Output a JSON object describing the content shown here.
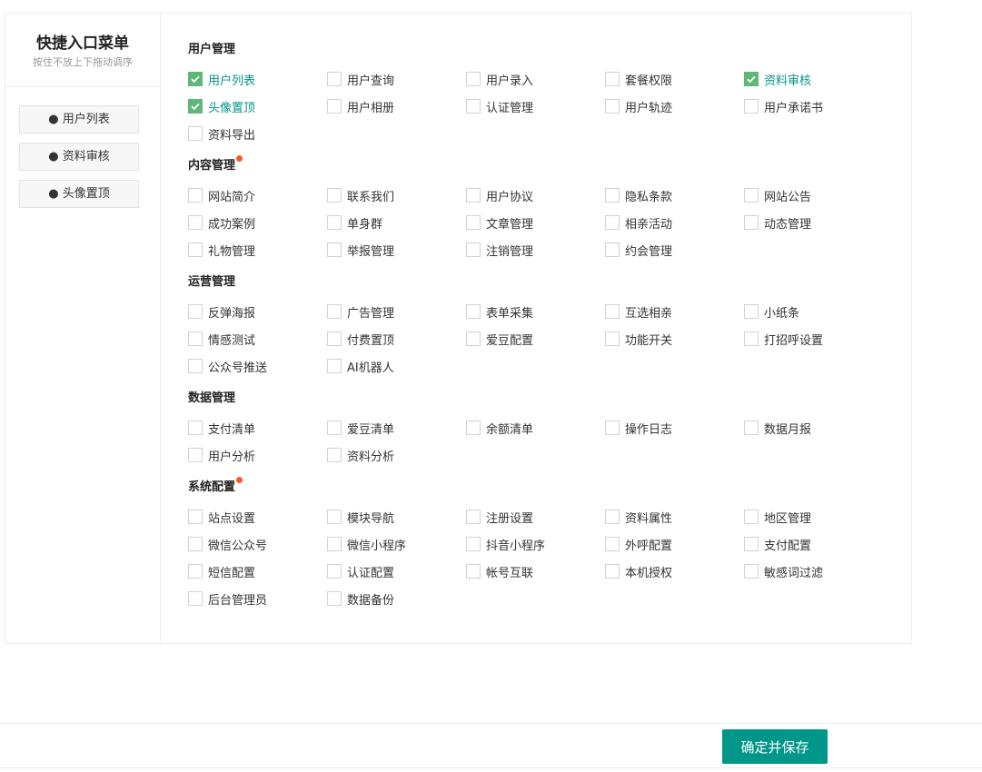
{
  "sidebar": {
    "title": "快捷入口菜单",
    "subtitle": "按住不放上下拖动调序",
    "items": [
      "● 用户列表",
      "● 资料审核",
      "● 头像置顶"
    ]
  },
  "accent": "#009688",
  "check_color": "#5fb878",
  "dot_color": "#ff5722",
  "sections": [
    {
      "title": "用户管理",
      "dot": false,
      "items": [
        {
          "l": "用户列表",
          "c": true
        },
        {
          "l": "用户查询"
        },
        {
          "l": "用户录入"
        },
        {
          "l": "套餐权限"
        },
        {
          "l": "资料审核",
          "c": true
        },
        {
          "l": "头像置顶",
          "c": true
        },
        {
          "l": "用户相册"
        },
        {
          "l": "认证管理"
        },
        {
          "l": "用户轨迹"
        },
        {
          "l": "用户承诺书"
        },
        {
          "l": "资料导出"
        }
      ]
    },
    {
      "title": "内容管理",
      "dot": true,
      "items": [
        {
          "l": "网站简介"
        },
        {
          "l": "联系我们"
        },
        {
          "l": "用户协议"
        },
        {
          "l": "隐私条款"
        },
        {
          "l": "网站公告"
        },
        {
          "l": "成功案例"
        },
        {
          "l": "单身群"
        },
        {
          "l": "文章管理"
        },
        {
          "l": "相亲活动"
        },
        {
          "l": "动态管理"
        },
        {
          "l": "礼物管理"
        },
        {
          "l": "举报管理"
        },
        {
          "l": "注销管理"
        },
        {
          "l": "约会管理"
        }
      ]
    },
    {
      "title": "运营管理",
      "dot": false,
      "items": [
        {
          "l": "反弹海报"
        },
        {
          "l": "广告管理"
        },
        {
          "l": "表单采集"
        },
        {
          "l": "互选相亲"
        },
        {
          "l": "小纸条"
        },
        {
          "l": "情感测试"
        },
        {
          "l": "付费置顶"
        },
        {
          "l": "爱豆配置"
        },
        {
          "l": "功能开关"
        },
        {
          "l": "打招呼设置"
        },
        {
          "l": "公众号推送"
        },
        {
          "l": "AI机器人"
        }
      ]
    },
    {
      "title": "数据管理",
      "dot": false,
      "items": [
        {
          "l": "支付清单"
        },
        {
          "l": "爱豆清单"
        },
        {
          "l": "余额清单"
        },
        {
          "l": "操作日志"
        },
        {
          "l": "数据月报"
        },
        {
          "l": "用户分析"
        },
        {
          "l": "资料分析"
        }
      ]
    },
    {
      "title": "系统配置",
      "dot": true,
      "items": [
        {
          "l": "站点设置"
        },
        {
          "l": "模块导航"
        },
        {
          "l": "注册设置"
        },
        {
          "l": "资料属性"
        },
        {
          "l": "地区管理"
        },
        {
          "l": "微信公众号"
        },
        {
          "l": "微信小程序"
        },
        {
          "l": "抖音小程序"
        },
        {
          "l": "外呼配置"
        },
        {
          "l": "支付配置"
        },
        {
          "l": "短信配置"
        },
        {
          "l": "认证配置"
        },
        {
          "l": "帐号互联"
        },
        {
          "l": "本机授权"
        },
        {
          "l": "敏感词过滤"
        },
        {
          "l": "后台管理员"
        },
        {
          "l": "数据备份"
        }
      ]
    }
  ],
  "footer": {
    "save_label": "确定并保存"
  }
}
